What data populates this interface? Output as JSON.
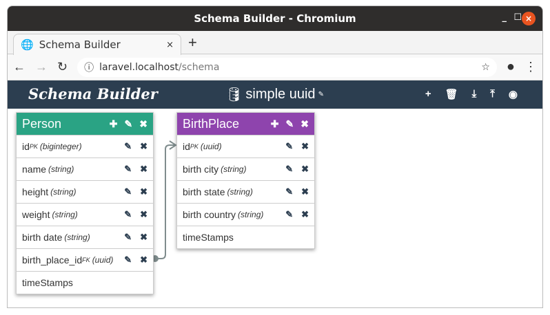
{
  "window": {
    "title": "Schema Builder - Chromium",
    "min": "_",
    "max": "☐",
    "close": "×"
  },
  "tab": {
    "label": "Schema Builder",
    "close": "×",
    "new": "+"
  },
  "address": {
    "host": "laravel.localhost",
    "path": "/schema"
  },
  "app": {
    "logo": "Schema Builder",
    "project": "simple uuid",
    "tools": [
      "+",
      "🗑",
      "⤓",
      "⤒",
      "◉"
    ]
  },
  "tables": [
    {
      "name": "Person",
      "color": "#2aa384",
      "fields": [
        {
          "name": "id",
          "key": "PK",
          "type": "(biginteger)"
        },
        {
          "name": "name",
          "key": "",
          "type": "(string)"
        },
        {
          "name": "height",
          "key": "",
          "type": "(string)"
        },
        {
          "name": "weight",
          "key": "",
          "type": "(string)"
        },
        {
          "name": "birth date",
          "key": "",
          "type": "(string)"
        },
        {
          "name": "birth_place_id",
          "key": "FK",
          "type": "(uuid)"
        }
      ],
      "footer": "timeStamps"
    },
    {
      "name": "BirthPlace",
      "color": "#8e44ad",
      "fields": [
        {
          "name": "id",
          "key": "PK",
          "type": "(uuid)"
        },
        {
          "name": "birth city",
          "key": "",
          "type": "(string)"
        },
        {
          "name": "birth state",
          "key": "",
          "type": "(string)"
        },
        {
          "name": "birth country",
          "key": "",
          "type": "(string)"
        }
      ],
      "footer": "timeStamps"
    }
  ]
}
